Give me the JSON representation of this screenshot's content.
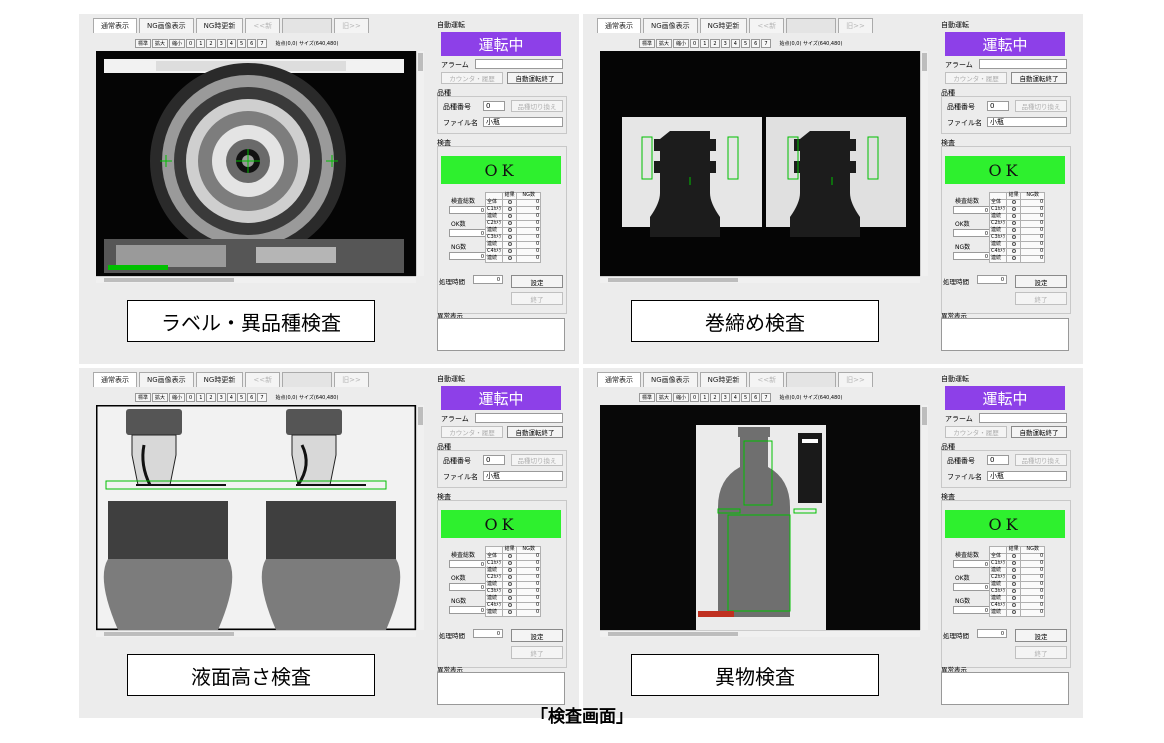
{
  "tabs": [
    "通常表示",
    "NG画像表示",
    "NG時更新",
    "<<新",
    "旧>>"
  ],
  "toolbar": {
    "buttons": [
      "標準",
      "拡大",
      "縮小",
      "0",
      "1",
      "2",
      "3",
      "4",
      "5",
      "6",
      "7"
    ],
    "info": "始点(0,0) サイズ(640,480)"
  },
  "side": {
    "auto_group": "自動運転",
    "status": "運転中",
    "alarm_label": "アラーム",
    "counter_btn": "カウンタ・履歴",
    "auto_end_btn": "自動運転終了",
    "product_group": "品種",
    "product_no_label": "品種番号",
    "product_no": "0",
    "switch_btn": "品種切り換え",
    "file_label": "ファイル名",
    "file_name": "小瓶",
    "inspect_group": "検査",
    "result": "OK",
    "total_label": "検査総数",
    "ok_label": "OK数",
    "ng_label": "NG数",
    "count_value": "0",
    "table_head": [
      "結果",
      "NG数"
    ],
    "table_rows": [
      "全体",
      "C1ｶﾒﾗ",
      "連続",
      "C2ｶﾒﾗ",
      "連続",
      "C3ｶﾒﾗ",
      "連続",
      "C4ｶﾒﾗ",
      "連続"
    ],
    "ng_value": "0",
    "time_label": "処理時間",
    "time_value": "0",
    "settings_btn": "設定",
    "end_btn": "終了",
    "error_label": "異常表示"
  },
  "panels": [
    {
      "caption": "ラベル・異品種検査"
    },
    {
      "caption": "巻締め検査"
    },
    {
      "caption": "液面高さ検査"
    },
    {
      "caption": "異物検査"
    }
  ],
  "figure_title": "「検査画面」",
  "colors": {
    "status_bg": "#8d40e8",
    "ok_bg": "#2ef02e",
    "overlay": "#00c000"
  }
}
